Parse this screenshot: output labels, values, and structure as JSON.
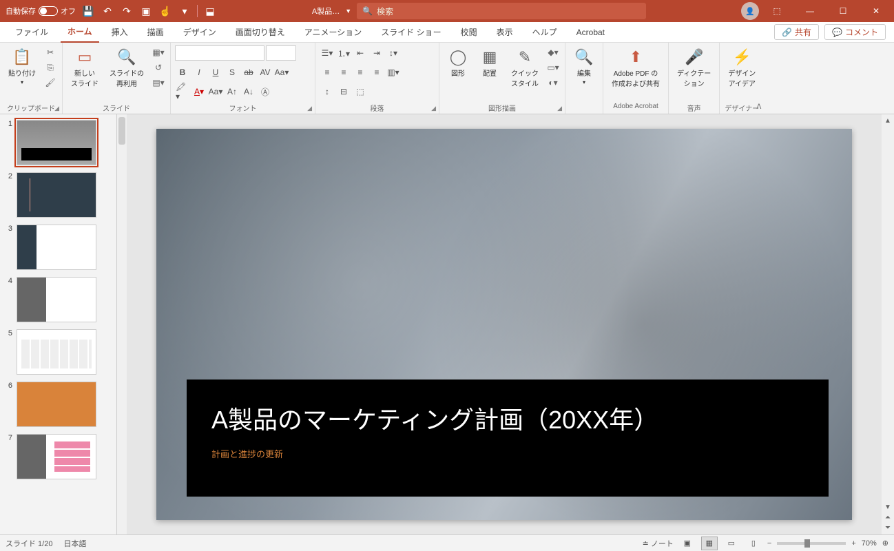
{
  "titlebar": {
    "autosave_label": "自動保存",
    "autosave_state": "オフ",
    "filename": "A製品…",
    "search_placeholder": "検索"
  },
  "tabs": {
    "file": "ファイル",
    "home": "ホーム",
    "insert": "挿入",
    "draw": "描画",
    "design": "デザイン",
    "transition": "画面切り替え",
    "animation": "アニメーション",
    "slideshow": "スライド ショー",
    "review": "校閲",
    "view": "表示",
    "help": "ヘルプ",
    "acrobat": "Acrobat",
    "share": "共有",
    "comment": "コメント"
  },
  "ribbon": {
    "clipboard": {
      "paste": "貼り付け",
      "label": "クリップボード"
    },
    "slides": {
      "new": "新しい\nスライド",
      "reuse": "スライドの\n再利用",
      "label": "スライド"
    },
    "font": {
      "label": "フォント"
    },
    "paragraph": {
      "label": "段落"
    },
    "drawing": {
      "shapes": "図形",
      "arrange": "配置",
      "quick": "クイック\nスタイル",
      "label": "図形描画"
    },
    "editing": {
      "edit": "編集",
      "label": ""
    },
    "acrobat": {
      "pdf": "Adobe PDF の\n作成および共有",
      "label": "Adobe Acrobat"
    },
    "voice": {
      "dictate": "ディクテー\nション",
      "label": "音声"
    },
    "designer": {
      "ideas": "デザイン\nアイデア",
      "label": "デザイナー"
    }
  },
  "thumbs": [
    "1",
    "2",
    "3",
    "4",
    "5",
    "6",
    "7"
  ],
  "slide": {
    "title": "A製品のマーケティング計画（20XX年）",
    "subtitle": "計画と進捗の更新"
  },
  "status": {
    "slide": "スライド 1/20",
    "lang": "日本語",
    "notes": "ノート",
    "zoom": "70%"
  }
}
